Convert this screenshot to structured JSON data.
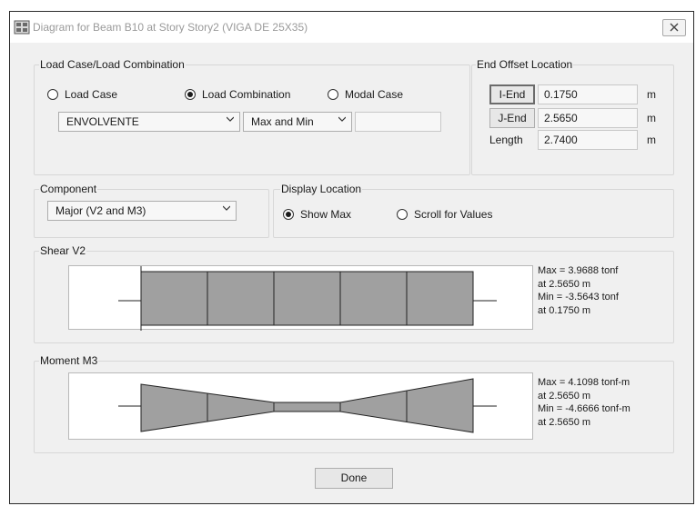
{
  "window": {
    "title": "Diagram for Beam B10 at Story Story2 (VIGA DE 25X35)"
  },
  "load_case": {
    "group_label": "Load Case/Load Combination",
    "options": [
      "Load Case",
      "Load Combination",
      "Modal Case"
    ],
    "selected_option": "Load Combination",
    "combination_value": "ENVOLVENTE",
    "mode_value": "Max and Min",
    "extra_value": ""
  },
  "end_offset": {
    "group_label": "End Offset Location",
    "iend_label": "I-End",
    "iend_value": "0.1750",
    "jend_label": "J-End",
    "jend_value": "2.5650",
    "length_label": "Length",
    "length_value": "2.7400",
    "unit": "m"
  },
  "component": {
    "group_label": "Component",
    "value": "Major (V2 and M3)"
  },
  "display_location": {
    "group_label": "Display Location",
    "options": [
      "Show Max",
      "Scroll for Values"
    ],
    "selected_option": "Show Max"
  },
  "shear": {
    "group_label": "Shear V2",
    "max_text": "Max = 3.9688 tonf",
    "max_at": "at 2.5650 m",
    "min_text": "Min = -3.5643 tonf",
    "min_at": "at 0.1750 m"
  },
  "moment": {
    "group_label": "Moment M3",
    "max_text": "Max = 4.1098 tonf-m",
    "max_at": "at 2.5650 m",
    "min_text": "Min = -4.6666 tonf-m",
    "min_at": "at 2.5650 m"
  },
  "done_label": "Done",
  "colors": {
    "diagram_fill": "#a0a0a0",
    "panel_bg": "#f0f0f0"
  }
}
